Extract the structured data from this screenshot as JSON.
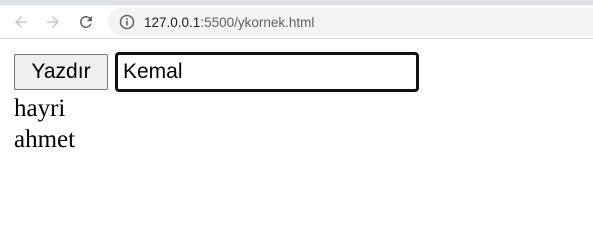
{
  "browser": {
    "url_host": "127.0.0.1",
    "url_path": ":5500/ykornek.html"
  },
  "page": {
    "button_label": "Yazdır",
    "input_value": "Kemal",
    "lines": [
      "hayri",
      "ahmet"
    ]
  }
}
